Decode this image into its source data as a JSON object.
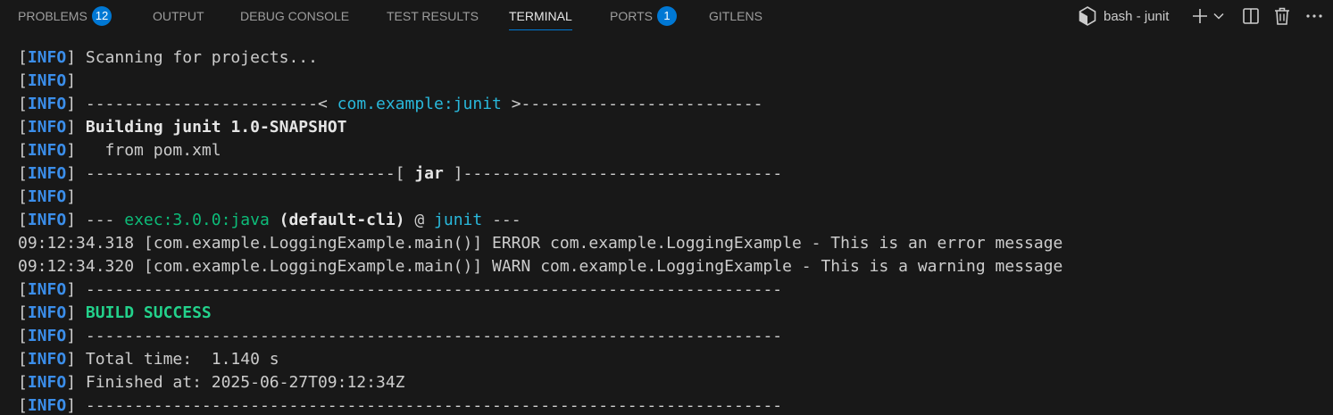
{
  "tabs": [
    {
      "label": "PROBLEMS",
      "badge": "12"
    },
    {
      "label": "OUTPUT"
    },
    {
      "label": "DEBUG CONSOLE"
    },
    {
      "label": "TEST RESULTS"
    },
    {
      "label": "TERMINAL",
      "active": true
    },
    {
      "label": "PORTS",
      "badge": "1"
    },
    {
      "label": "GITLENS"
    }
  ],
  "terminal_actions": {
    "title": "bash - junit",
    "icons": [
      "bash-shell-icon",
      "new-terminal-plus-icon",
      "terminal-dropdown-chevron-icon",
      "split-terminal-icon",
      "kill-terminal-trash-icon",
      "more-actions-ellipsis-icon"
    ]
  },
  "colors": {
    "background": "#181818",
    "accent": "#0078d4",
    "info_tag": "#3b8eea",
    "project_cyan": "#29b8db",
    "success_green": "#23d18b",
    "exec_green": "#0dbc79"
  },
  "terminal": {
    "lines": [
      [
        {
          "t": "[",
          "c": "br"
        },
        {
          "t": "INFO",
          "c": "info"
        },
        {
          "t": "] Scanning for projects...",
          "c": ""
        }
      ],
      [
        {
          "t": "[",
          "c": "br"
        },
        {
          "t": "INFO",
          "c": "info"
        },
        {
          "t": "]",
          "c": ""
        }
      ],
      [
        {
          "t": "[",
          "c": "br"
        },
        {
          "t": "INFO",
          "c": "info"
        },
        {
          "t": "] ------------------------< ",
          "c": ""
        },
        {
          "t": "com.example:junit",
          "c": "cyan"
        },
        {
          "t": " >-------------------------",
          "c": ""
        }
      ],
      [
        {
          "t": "[",
          "c": "br"
        },
        {
          "t": "INFO",
          "c": "info"
        },
        {
          "t": "] ",
          "c": ""
        },
        {
          "t": "Building junit 1.0-SNAPSHOT",
          "c": "bold"
        }
      ],
      [
        {
          "t": "[",
          "c": "br"
        },
        {
          "t": "INFO",
          "c": "info"
        },
        {
          "t": "]   from pom.xml",
          "c": ""
        }
      ],
      [
        {
          "t": "[",
          "c": "br"
        },
        {
          "t": "INFO",
          "c": "info"
        },
        {
          "t": "] --------------------------------[ ",
          "c": ""
        },
        {
          "t": "jar",
          "c": "bold"
        },
        {
          "t": " ]---------------------------------",
          "c": ""
        }
      ],
      [
        {
          "t": "[",
          "c": "br"
        },
        {
          "t": "INFO",
          "c": "info"
        },
        {
          "t": "]",
          "c": ""
        }
      ],
      [
        {
          "t": "[",
          "c": "br"
        },
        {
          "t": "INFO",
          "c": "info"
        },
        {
          "t": "] --- ",
          "c": ""
        },
        {
          "t": "exec:3.0.0:java",
          "c": "exec"
        },
        {
          "t": " ",
          "c": ""
        },
        {
          "t": "(default-cli)",
          "c": "bold"
        },
        {
          "t": " @ ",
          "c": ""
        },
        {
          "t": "junit",
          "c": "cyan"
        },
        {
          "t": " ---",
          "c": ""
        }
      ],
      [
        {
          "t": "09:12:34.318 [com.example.LoggingExample.main()] ERROR com.example.LoggingExample - This is an error message",
          "c": ""
        }
      ],
      [
        {
          "t": "09:12:34.320 [com.example.LoggingExample.main()] WARN com.example.LoggingExample - This is a warning message",
          "c": ""
        }
      ],
      [
        {
          "t": "[",
          "c": "br"
        },
        {
          "t": "INFO",
          "c": "info"
        },
        {
          "t": "] ------------------------------------------------------------------------",
          "c": ""
        }
      ],
      [
        {
          "t": "[",
          "c": "br"
        },
        {
          "t": "INFO",
          "c": "info"
        },
        {
          "t": "] ",
          "c": ""
        },
        {
          "t": "BUILD SUCCESS",
          "c": "green"
        }
      ],
      [
        {
          "t": "[",
          "c": "br"
        },
        {
          "t": "INFO",
          "c": "info"
        },
        {
          "t": "] ------------------------------------------------------------------------",
          "c": ""
        }
      ],
      [
        {
          "t": "[",
          "c": "br"
        },
        {
          "t": "INFO",
          "c": "info"
        },
        {
          "t": "] Total time:  1.140 s",
          "c": ""
        }
      ],
      [
        {
          "t": "[",
          "c": "br"
        },
        {
          "t": "INFO",
          "c": "info"
        },
        {
          "t": "] Finished at: 2025-06-27T09:12:34Z",
          "c": ""
        }
      ],
      [
        {
          "t": "[",
          "c": "br"
        },
        {
          "t": "INFO",
          "c": "info"
        },
        {
          "t": "] ------------------------------------------------------------------------",
          "c": ""
        }
      ]
    ]
  }
}
